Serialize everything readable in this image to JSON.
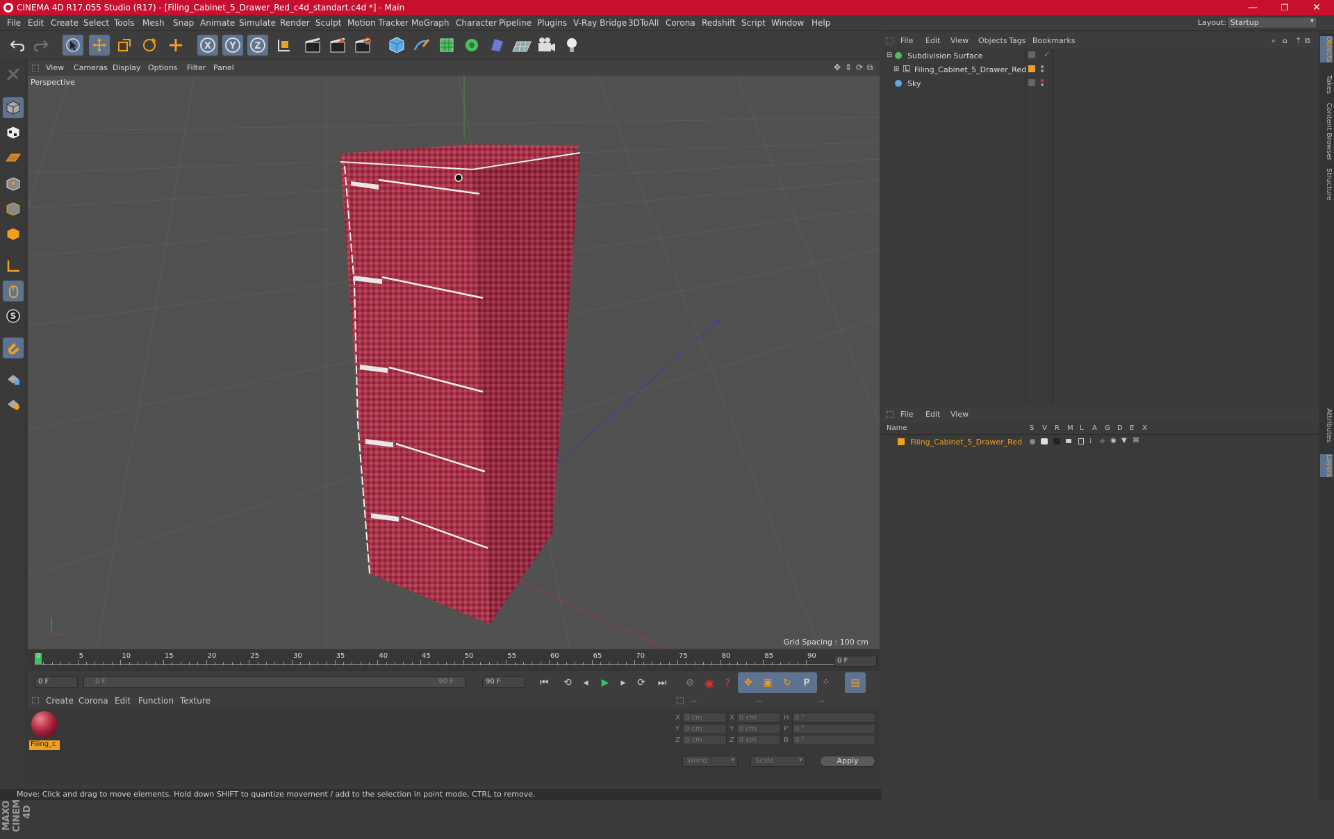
{
  "titlebar": {
    "title": "CINEMA 4D R17.055 Studio (R17) - [Filing_Cabinet_5_Drawer_Red_c4d_standart.c4d *] - Main",
    "minimize": "—",
    "maximize": "❐",
    "close": "✕"
  },
  "menubar": {
    "items": [
      "File",
      "Edit",
      "Create",
      "Select",
      "Tools",
      "Mesh",
      "Snap",
      "Animate",
      "Simulate",
      "Render",
      "Sculpt",
      "Motion Tracker",
      "MoGraph",
      "Character",
      "Pipeline",
      "Plugins",
      "V-Ray Bridge",
      "3DToAll",
      "Corona",
      "Redshift",
      "Script",
      "Window",
      "Help"
    ],
    "layout_label": "Layout:",
    "layout_value": "Startup"
  },
  "viewport": {
    "menu": [
      "View",
      "Cameras",
      "Display",
      "Options",
      "Filter",
      "Panel"
    ],
    "label": "Perspective",
    "grid_spacing": "Grid Spacing : 100 cm"
  },
  "timeline": {
    "ticks": [
      "0",
      "5",
      "10",
      "15",
      "20",
      "25",
      "30",
      "35",
      "40",
      "45",
      "50",
      "55",
      "60",
      "65",
      "70",
      "75",
      "80",
      "85",
      "90"
    ],
    "current_frame": "0 F"
  },
  "transport": {
    "start_field": "0 F",
    "slider_left": "0 F",
    "slider_right": "90 F",
    "end_field": "90 F"
  },
  "material_panel": {
    "menu": [
      "Create",
      "Corona",
      "Edit",
      "Function",
      "Texture"
    ],
    "material_name": "Filing_c"
  },
  "coord_panel": {
    "headers": [
      "--",
      "--",
      "--"
    ],
    "rows": [
      {
        "a": "X",
        "av": "0 cm",
        "b": "X",
        "bv": "0 cm",
        "c": "H",
        "cv": "0 °"
      },
      {
        "a": "Y",
        "av": "0 cm",
        "b": "Y",
        "bv": "0 cm",
        "c": "P",
        "cv": "0 °"
      },
      {
        "a": "Z",
        "av": "0 cm",
        "b": "Z",
        "bv": "0 cm",
        "c": "B",
        "cv": "0 °"
      }
    ],
    "world": "World",
    "scale": "Scale",
    "apply": "Apply"
  },
  "object_manager": {
    "menu": [
      "File",
      "Edit",
      "View",
      "Objects",
      "Tags",
      "Bookmarks"
    ],
    "objects": [
      {
        "name": "Subdivision Surface"
      },
      {
        "name": "Filing_Cabinet_5_Drawer_Red"
      },
      {
        "name": "Sky"
      }
    ]
  },
  "layer_manager": {
    "menu": [
      "File",
      "Edit",
      "View"
    ],
    "name_header": "Name",
    "columns": [
      "S",
      "V",
      "R",
      "M",
      "L",
      "A",
      "G",
      "D",
      "E",
      "X"
    ],
    "layer_name": "Filing_Cabinet_5_Drawer_Red"
  },
  "right_tabs": [
    "Objects",
    "Takes",
    "Content Browser",
    "Structure",
    "Attributes",
    "Layers"
  ],
  "branding": "MAXON CINEMA 4D",
  "statusbar": "Move: Click and drag to move elements. Hold down SHIFT to quantize movement / add to the selection in point mode, CTRL to remove.",
  "colors": {
    "titlebar": "#c8102e",
    "accent_orange": "#f0a020",
    "cabinet_red": "#a8324a",
    "selection_blue": "#5d7390"
  }
}
